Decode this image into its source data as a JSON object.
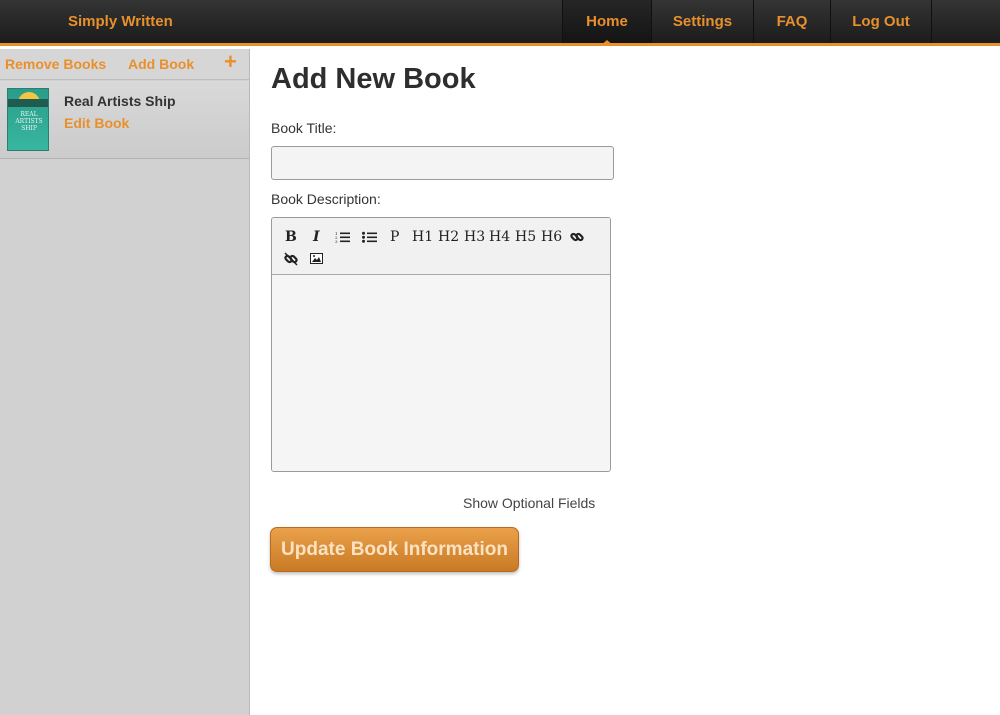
{
  "header": {
    "brand": "Simply Written",
    "nav": [
      {
        "label": "Home",
        "active": true
      },
      {
        "label": "Settings",
        "active": false
      },
      {
        "label": "FAQ",
        "active": false
      },
      {
        "label": "Log Out",
        "active": false
      }
    ],
    "accent_color": "#e8902c"
  },
  "sidebar": {
    "remove_label": "Remove Books",
    "add_label": "Add Book",
    "add_icon": "plus-icon",
    "books": [
      {
        "title": "Real Artists Ship",
        "edit_label": "Edit Book",
        "cover_text": "REAL ARTISTS SHIP"
      }
    ]
  },
  "main": {
    "title": "Add New Book",
    "book_title_label": "Book Title:",
    "book_title_value": "",
    "book_description_label": "Book Description:",
    "toolbar": {
      "bold": "B",
      "italic": "I",
      "ordered_list": "ordered-list-icon",
      "unordered_list": "unordered-list-icon",
      "paragraph": "P",
      "h1": "H1",
      "h2": "H2",
      "h3": "H3",
      "h4": "H4",
      "h5": "H5",
      "h6": "H6",
      "link": "link-icon",
      "unlink": "unlink-icon",
      "image": "image-icon"
    },
    "show_optional_label": "Show Optional Fields",
    "update_button_label": "Update Book Information"
  }
}
